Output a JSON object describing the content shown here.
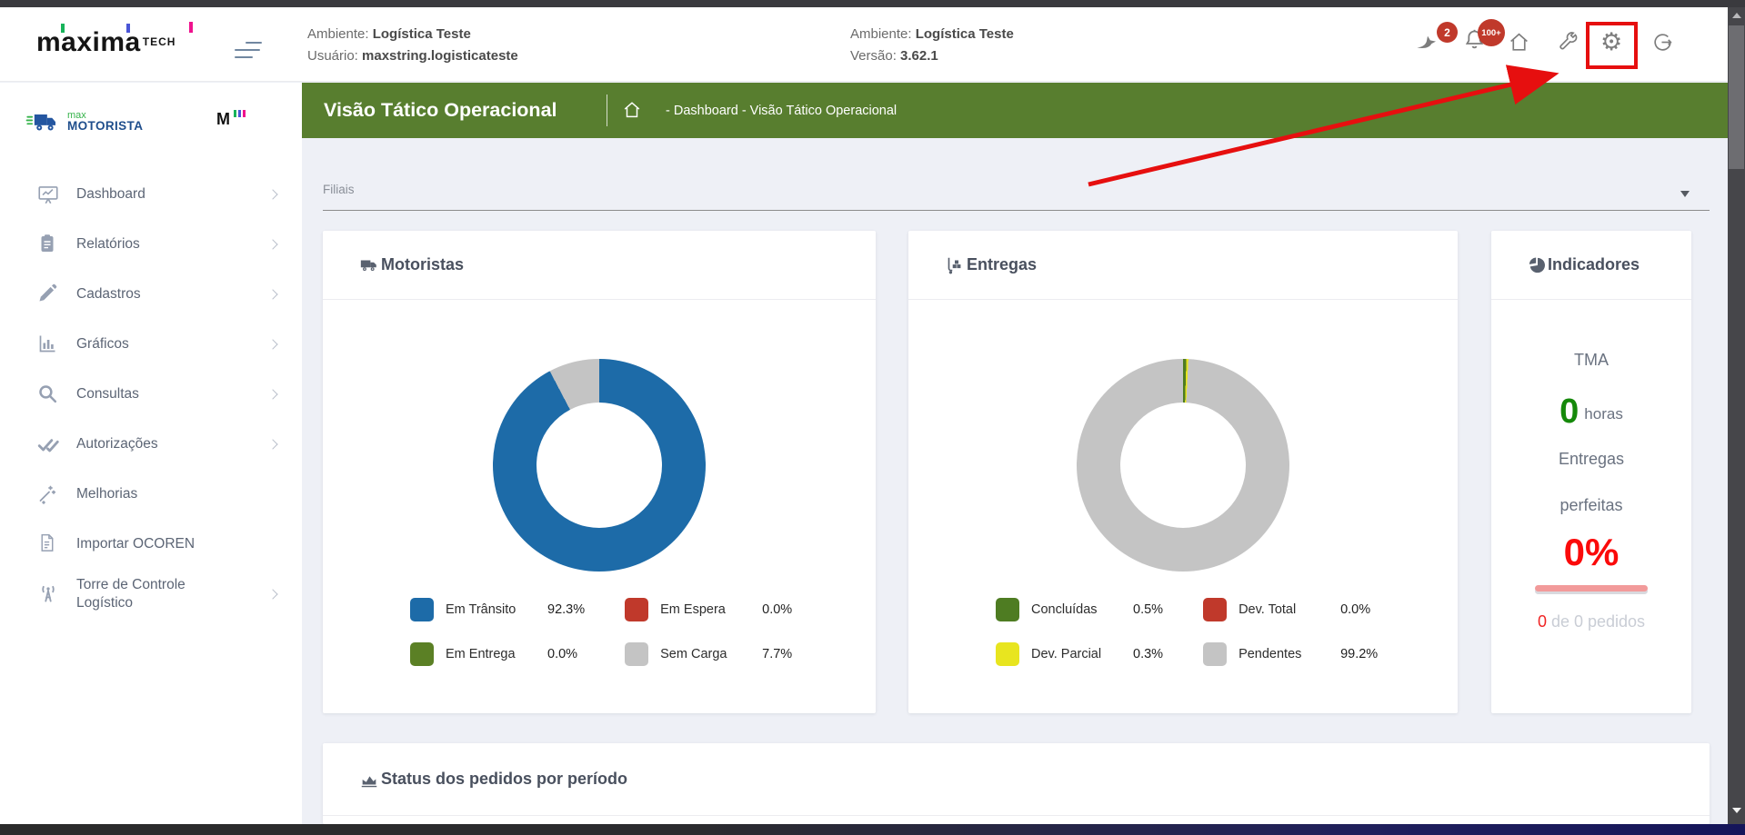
{
  "header": {
    "logo": {
      "brand": "maxima",
      "suffix": "TECH"
    },
    "ambiente1": {
      "label": "Ambiente:",
      "value": "Logística Teste"
    },
    "usuario": {
      "label": "Usuário:",
      "value": "maxstring.logisticateste"
    },
    "ambiente2": {
      "label": "Ambiente:",
      "value": "Logística Teste"
    },
    "versao": {
      "label": "Versão:",
      "value": "3.62.1"
    },
    "badges": {
      "announcements": "2",
      "notifications": "100+"
    }
  },
  "sidebar": {
    "logo": {
      "top": "max",
      "bottom": "MOTORISTA",
      "mini": "M"
    },
    "items": [
      {
        "label": "Dashboard"
      },
      {
        "label": "Relatórios"
      },
      {
        "label": "Cadastros"
      },
      {
        "label": "Gráficos"
      },
      {
        "label": "Consultas"
      },
      {
        "label": "Autorizações"
      },
      {
        "label": "Melhorias"
      },
      {
        "label": "Importar OCOREN"
      },
      {
        "label": "Torre de Controle Logístico"
      }
    ]
  },
  "titlebar": {
    "title": "Visão Tático Operacional",
    "breadcrumb": "- Dashboard - Visão Tático Operacional"
  },
  "filters": {
    "filiais_label": "Filiais"
  },
  "cards": {
    "motoristas": {
      "title": "Motoristas",
      "chart_data": {
        "type": "pie",
        "donut": true,
        "labels": [
          "Em Trânsito",
          "Em Espera",
          "Em Entrega",
          "Sem Carga"
        ],
        "values": [
          92.3,
          0.0,
          0.0,
          7.7
        ],
        "colors": [
          "#1d6ba8",
          "#c0392b",
          "#5b8025",
          "#c4c4c4"
        ]
      },
      "legend": [
        {
          "label": "Em Trânsito",
          "value": "92.3%",
          "color": "#1d6ba8"
        },
        {
          "label": "Em Espera",
          "value": "0.0%",
          "color": "#c0392b"
        },
        {
          "label": "Em Entrega",
          "value": "0.0%",
          "color": "#5b8025"
        },
        {
          "label": "Sem Carga",
          "value": "7.7%",
          "color": "#c4c4c4"
        }
      ]
    },
    "entregas": {
      "title": "Entregas",
      "chart_data": {
        "type": "pie",
        "donut": true,
        "labels": [
          "Concluídas",
          "Dev. Total",
          "Dev. Parcial",
          "Pendentes"
        ],
        "values": [
          0.5,
          0.0,
          0.3,
          99.2
        ],
        "colors": [
          "#4e7c22",
          "#c0392b",
          "#e8e51f",
          "#c4c4c4"
        ]
      },
      "legend": [
        {
          "label": "Concluídas",
          "value": "0.5%",
          "color": "#4e7c22"
        },
        {
          "label": "Dev. Total",
          "value": "0.0%",
          "color": "#c0392b"
        },
        {
          "label": "Dev. Parcial",
          "value": "0.3%",
          "color": "#e8e51f"
        },
        {
          "label": "Pendentes",
          "value": "99.2%",
          "color": "#c4c4c4"
        }
      ]
    },
    "indicadores": {
      "title": "Indicadores",
      "tma_label": "TMA",
      "tma_value": "0",
      "tma_unit": "horas",
      "line1": "Entregas",
      "line2": "perfeitas",
      "percent": "0%",
      "foot_value": "0",
      "foot_rest": " de 0 pedidos"
    },
    "status": {
      "title": "Status dos pedidos por período"
    }
  },
  "annotation": {
    "color": "#e60f0f"
  }
}
